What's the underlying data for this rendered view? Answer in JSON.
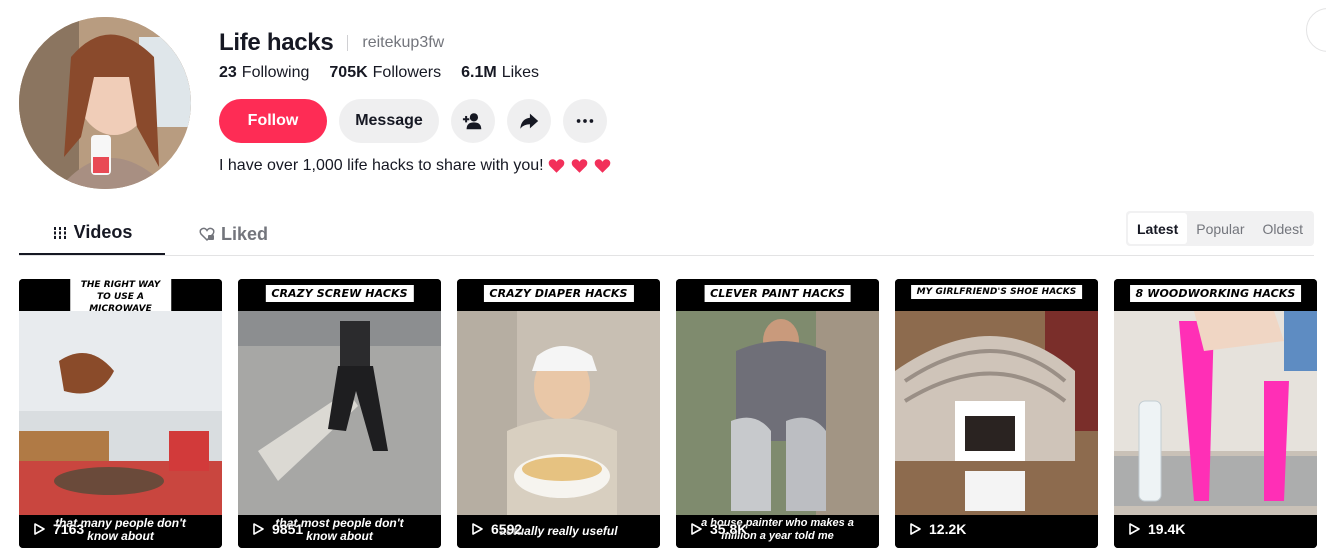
{
  "profile": {
    "display_name": "Life hacks",
    "username": "reitekup3fw",
    "bio": "I have over 1,000 life hacks to share with you!",
    "stats": {
      "following_count": "23",
      "following_label": "Following",
      "followers_count": "705K",
      "followers_label": "Followers",
      "likes_count": "6.1M",
      "likes_label": "Likes"
    }
  },
  "actions": {
    "follow_label": "Follow",
    "message_label": "Message",
    "add_friend_icon": "person-plus-icon",
    "share_icon": "share-arrow-icon",
    "more_icon": "more-horizontal-icon"
  },
  "tabs": [
    {
      "label": "Videos",
      "icon": "grid-icon",
      "active": true
    },
    {
      "label": "Liked",
      "icon": "heart-lock-icon",
      "active": false
    }
  ],
  "sort": [
    {
      "label": "Latest",
      "active": true
    },
    {
      "label": "Popular",
      "active": false
    },
    {
      "label": "Oldest",
      "active": false
    }
  ],
  "videos": [
    {
      "caption_line1": "THE RIGHT WAY",
      "caption_line2": "TO USE A MICROWAVE",
      "subtitle_line1": "that many people don't",
      "subtitle_line2": "know about",
      "views": "7163"
    },
    {
      "caption": "CRAZY SCREW HACKS",
      "subtitle_line1": "that most people don't",
      "subtitle_line2": "know about",
      "views": "9851"
    },
    {
      "caption": "CRAZY DIAPER HACKS",
      "subtitle_line1": "actually really useful",
      "views": "6592"
    },
    {
      "caption": "CLEVER PAINT HACKS",
      "subtitle_line1": "a house painter who makes a",
      "subtitle_line2": "million a year told me",
      "views": "35.8K"
    },
    {
      "caption": "MY GIRLFRIEND'S SHOE HACKS",
      "views": "12.2K"
    },
    {
      "caption": "8 WOODWORKING HACKS",
      "views": "19.4K"
    }
  ],
  "colors": {
    "brand": "#fe2c55",
    "text": "#161823",
    "muted": "#73757c",
    "heart": "#fe2c55"
  }
}
